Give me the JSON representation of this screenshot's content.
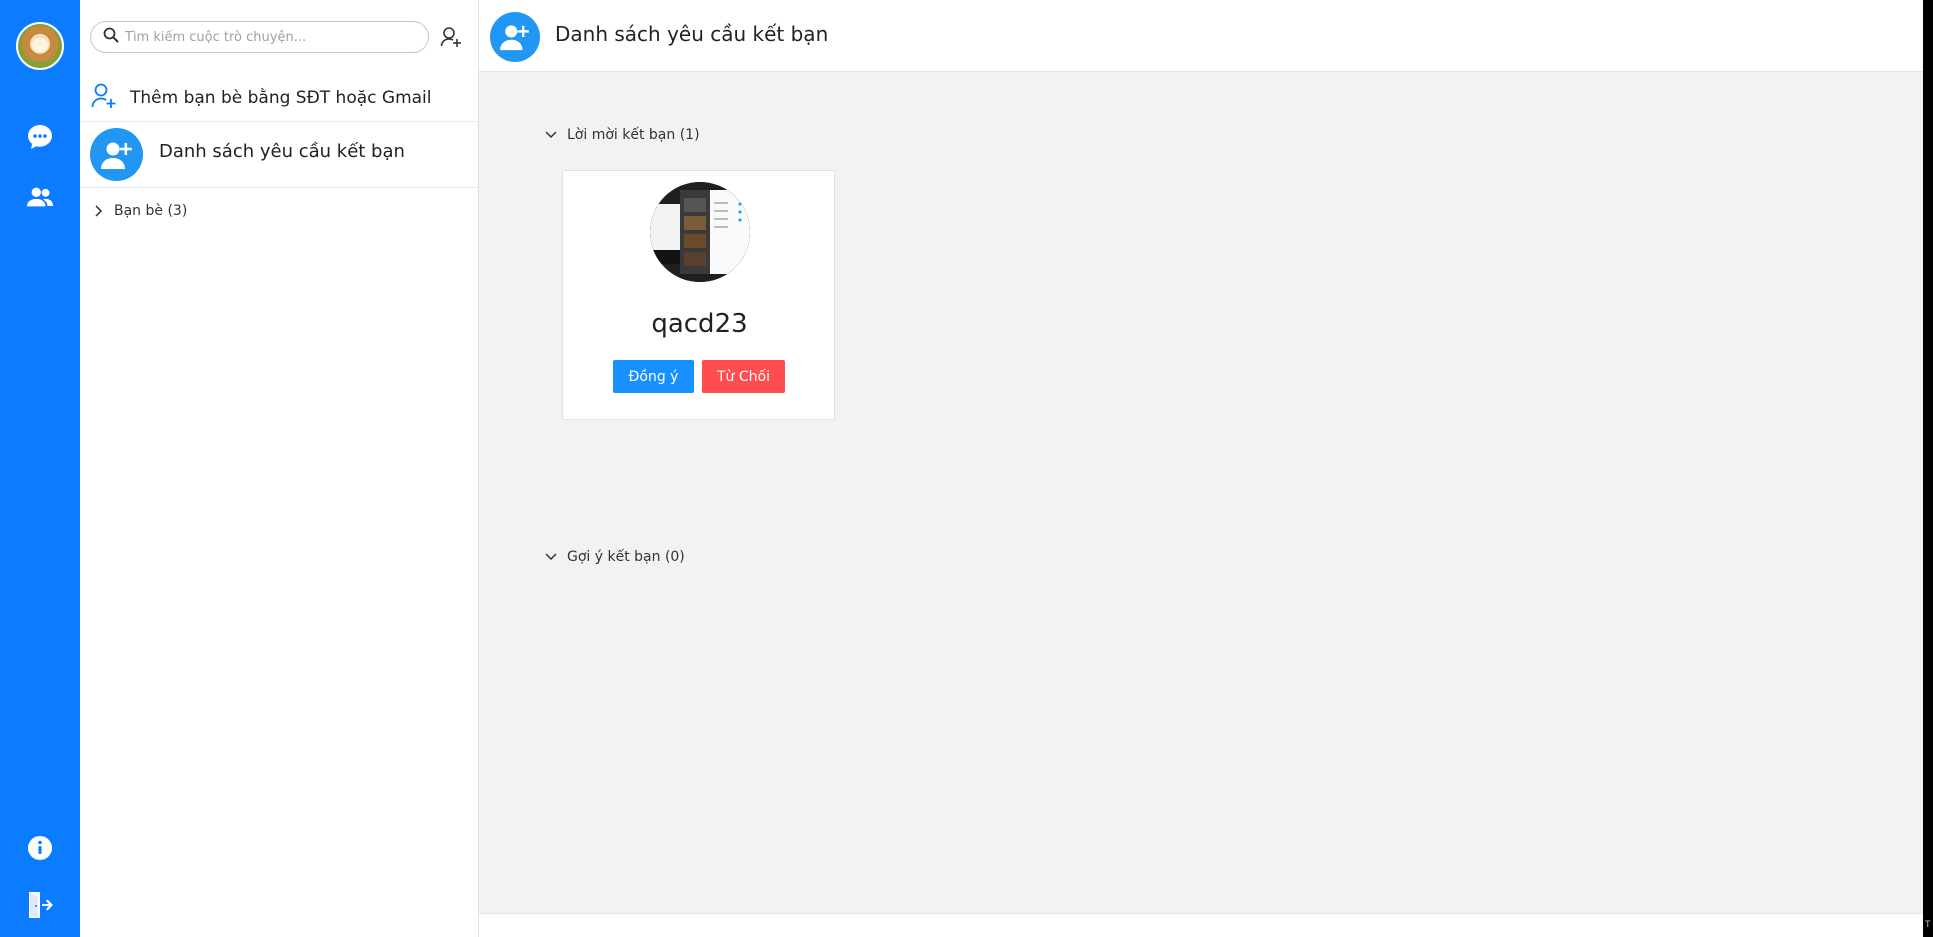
{
  "search": {
    "placeholder": "Tìm kiếm cuộc trò chuyện..."
  },
  "sidebar": {
    "add_by_phone_label": "Thêm bạn bè bằng SĐT hoặc Gmail",
    "friend_requests_label": "Danh sách yêu cầu kết bạn",
    "friends_toggle_label": "Bạn bè (3)"
  },
  "main": {
    "header_title": "Danh sách yêu cầu kết bạn",
    "invites_section_label": "Lời mời kết bạn (1)",
    "suggestions_section_label": "Gợi ý kết bạn (0)",
    "request_card": {
      "username": "qacd23",
      "accept_label": "Đồng ý",
      "reject_label": "Từ Chối"
    }
  },
  "colors": {
    "rail": "#0b7cff",
    "accent": "#2196f3",
    "accept": "#1890ff",
    "reject": "#ff4d4f",
    "main_bg": "#f2f2f2"
  },
  "icons": {
    "rail": [
      "chat-icon",
      "contacts-icon",
      "info-icon",
      "logout-icon"
    ],
    "search": "search-icon",
    "add_friend": "add-friend-icon",
    "add_by_phone": "user-plus-icon"
  },
  "corner_text": "T"
}
